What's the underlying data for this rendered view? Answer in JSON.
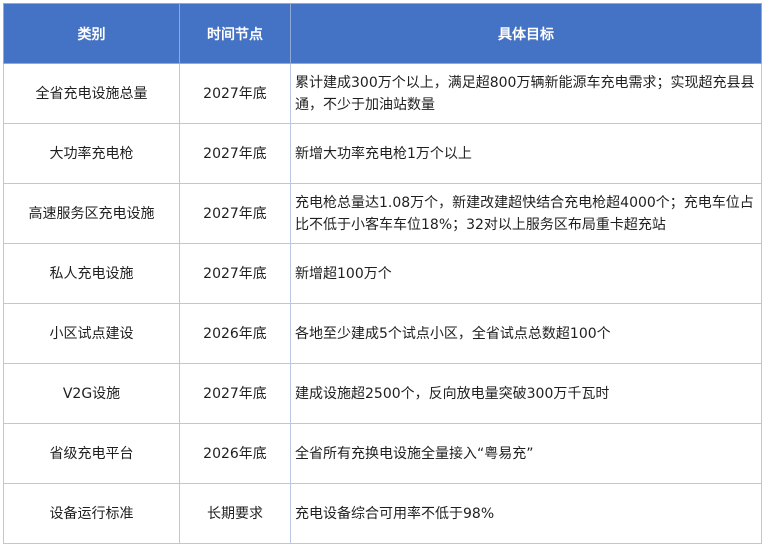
{
  "table": {
    "headers": [
      "类别",
      "时间节点",
      "具体目标"
    ],
    "rows": [
      {
        "category": "全省充电设施总量",
        "time": "2027年底",
        "goal": "累计建成300万个以上，满足超800万辆新能源车充电需求；实现超充县县通，不少于加油站数量"
      },
      {
        "category": "大功率充电枪",
        "time": "2027年底",
        "goal": "新增大功率充电枪1万个以上"
      },
      {
        "category": "高速服务区充电设施",
        "time": "2027年底",
        "goal": "充电枪总量达1.08万个，新建改建超快结合充电枪超4000个；充电车位占比不低于小客车车位18%；32对以上服务区布局重卡超充站"
      },
      {
        "category": "私人充电设施",
        "time": "2027年底",
        "goal": "新增超100万个"
      },
      {
        "category": "小区试点建设",
        "time": "2026年底",
        "goal": "各地至少建成5个试点小区，全省试点总数超100个"
      },
      {
        "category": "V2G设施",
        "time": "2027年底",
        "goal": "建成设施超2500个，反向放电量突破300万千瓦时"
      },
      {
        "category": "省级充电平台",
        "time": "2026年底",
        "goal": "全省所有充换电设施全量接入“粤易充”"
      },
      {
        "category": "设备运行标准",
        "time": "长期要求",
        "goal": "充电设备综合可用率不低于98%"
      }
    ]
  },
  "colors": {
    "header_bg": "#4472c4",
    "header_text": "#ffffff",
    "border": "#b8c7e3"
  }
}
